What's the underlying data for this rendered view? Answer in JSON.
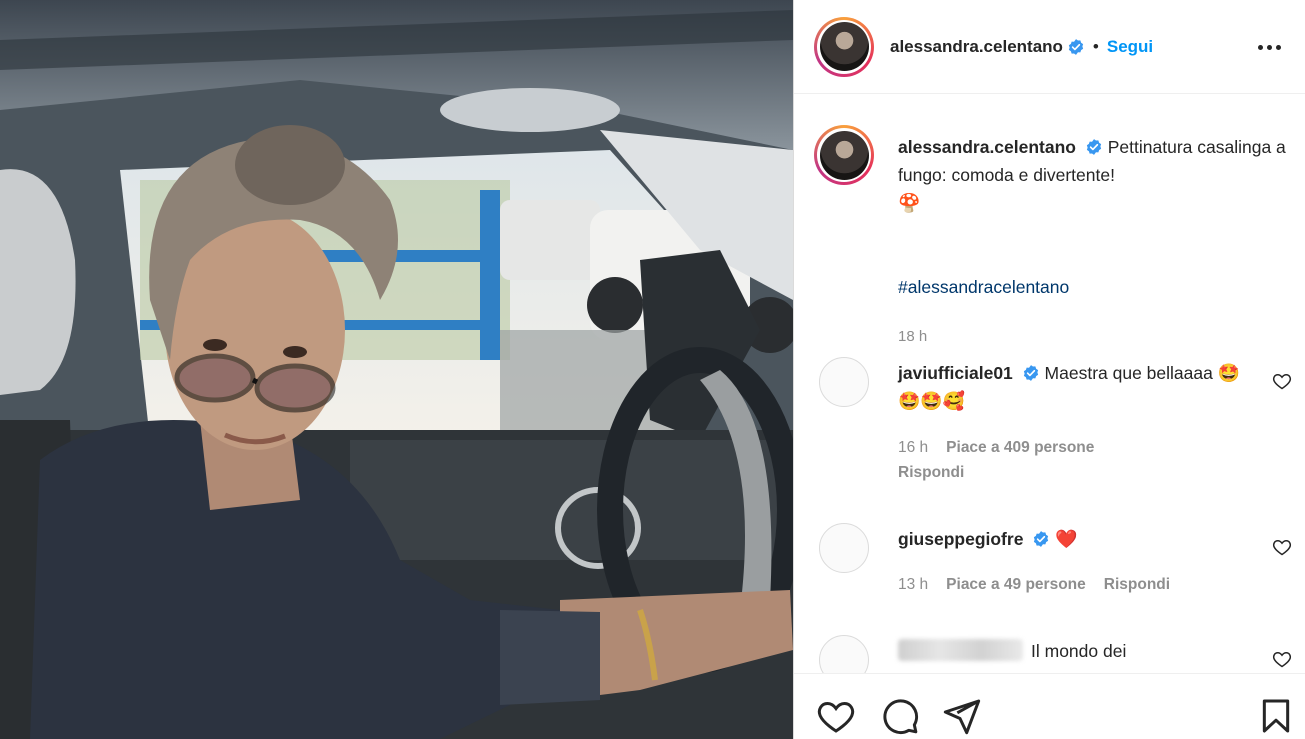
{
  "header": {
    "username": "alessandra.celentano",
    "separator": "•",
    "follow_label": "Segui"
  },
  "caption": {
    "username": "alessandra.celentano",
    "text": "Pettinatura casalinga a fungo: comoda e divertente!",
    "emoji": "🍄",
    "hashtag": "#alessandracelentano",
    "time": "18 h"
  },
  "comments": [
    {
      "username": "javiufficiale01",
      "text": "Maestra que bellaaaa",
      "emoji": "🤩🤩🤩🥰",
      "time": "16 h",
      "likes": "Piace a 409 persone",
      "reply": "Rispondi"
    },
    {
      "username": "giuseppegiofre",
      "text": "",
      "emoji": "❤️",
      "time": "13 h",
      "likes": "Piace a 49 persone",
      "reply": "Rispondi"
    },
    {
      "username": "",
      "text": "Il mondo dei"
    }
  ],
  "icons": {
    "verified": "verified-badge-icon",
    "more": "more-options-icon",
    "like": "heart-icon",
    "comment": "comment-icon",
    "share": "send-icon",
    "save": "bookmark-icon"
  },
  "colors": {
    "link": "#0095f6",
    "hashtag": "#00376b",
    "muted": "#8e8e8e",
    "verified": "#3897f0"
  }
}
